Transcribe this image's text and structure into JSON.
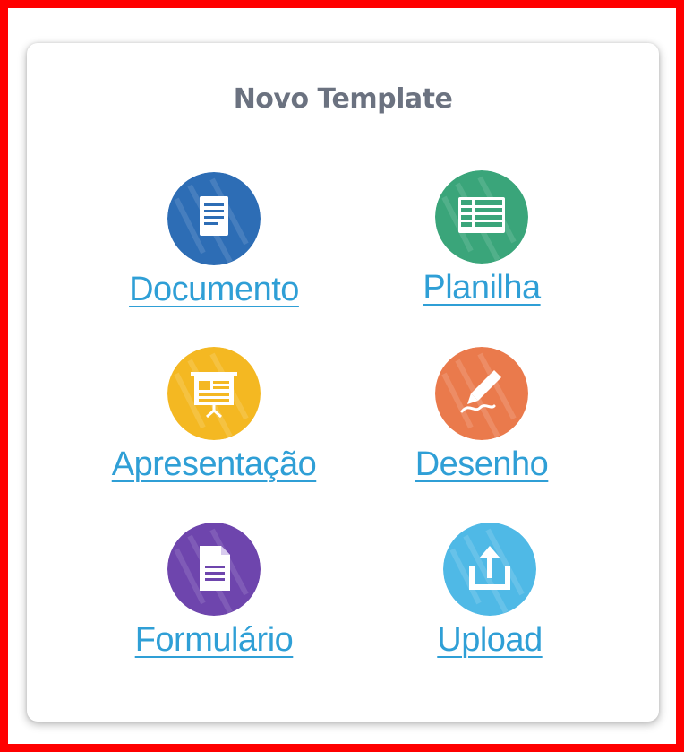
{
  "panel": {
    "title": "Novo Template"
  },
  "templates": [
    {
      "label": "Documento",
      "icon": "document-icon",
      "color": "#2d6db5"
    },
    {
      "label": "Planilha",
      "icon": "spreadsheet-icon",
      "color": "#3aa57a"
    },
    {
      "label": "Apresentação",
      "icon": "presentation-icon",
      "color": "#f4b822"
    },
    {
      "label": "Desenho",
      "icon": "drawing-icon",
      "color": "#ea7a4c"
    },
    {
      "label": "Formulário",
      "icon": "form-icon",
      "color": "#6e45ad"
    },
    {
      "label": "Upload",
      "icon": "upload-icon",
      "color": "#4fb9e6"
    }
  ],
  "theme": {
    "highlight_border": "#ff0000",
    "title_color": "#6b7280",
    "link_color": "#2f9fd6"
  }
}
